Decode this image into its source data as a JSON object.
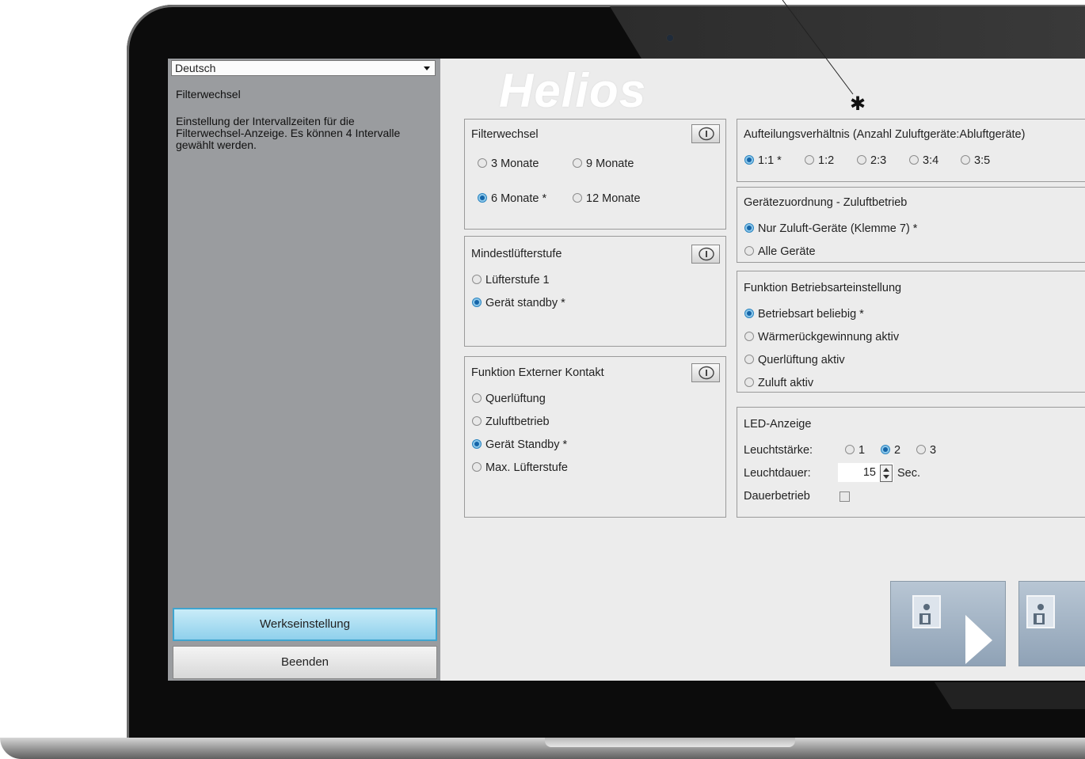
{
  "left_panel": {
    "language": "Deutsch",
    "title": "Filterwechsel",
    "description": "Einstellung der Intervallzeiten für die Filterwechsel-Anzeige. Es können 4 Intervalle gewählt werden.",
    "factory_button": "Werkseinstellung",
    "exit_button": "Beenden"
  },
  "logo": "Helios",
  "annotation_marker": "✱",
  "filter": {
    "title": "Filterwechsel",
    "options": [
      "3 Monate",
      "9 Monate",
      "6 Monate *",
      "12 Monate"
    ],
    "selected": "6 Monate *"
  },
  "min_fan": {
    "title": "Mindestlüfterstufe",
    "options": [
      "Lüfterstufe 1",
      "Gerät standby *"
    ],
    "selected": "Gerät standby *"
  },
  "ext_contact": {
    "title": "Funktion Externer Kontakt",
    "options": [
      "Querlüftung",
      "Zuluftbetrieb",
      "Gerät Standby *",
      "Max. Lüfterstufe"
    ],
    "selected": "Gerät Standby *"
  },
  "ratio": {
    "title": "Aufteilungsverhältnis (Anzahl Zuluftgeräte:Abluftgeräte)",
    "options": [
      "1:1 *",
      "1:2",
      "2:3",
      "3:4",
      "3:5"
    ],
    "selected": "1:1 *"
  },
  "assignment": {
    "title": "Gerätezuordnung - Zuluftbetrieb",
    "options": [
      "Nur Zuluft-Geräte (Klemme 7) *",
      "Alle Geräte"
    ],
    "selected": "Nur Zuluft-Geräte (Klemme 7) *"
  },
  "mode": {
    "title": "Funktion Betriebsarteinstellung",
    "options": [
      "Betriebsart beliebig *",
      "Wärmerückgewinnung aktiv",
      "Querlüftung aktiv",
      "Zuluft aktiv"
    ],
    "selected": "Betriebsart beliebig *"
  },
  "led": {
    "title": "LED-Anzeige",
    "brightness_label": "Leuchtstärke:",
    "brightness_options": [
      "1",
      "2",
      "3"
    ],
    "brightness_selected": "2",
    "duration_label": "Leuchtdauer:",
    "duration_value": "15",
    "duration_unit": "Sec.",
    "permanent_label": "Dauerbetrieb",
    "permanent_checked": false
  },
  "colors": {
    "accent": "#2a84c0",
    "left_panel_bg": "#9a9c9f",
    "screen_bg": "#ececec"
  }
}
